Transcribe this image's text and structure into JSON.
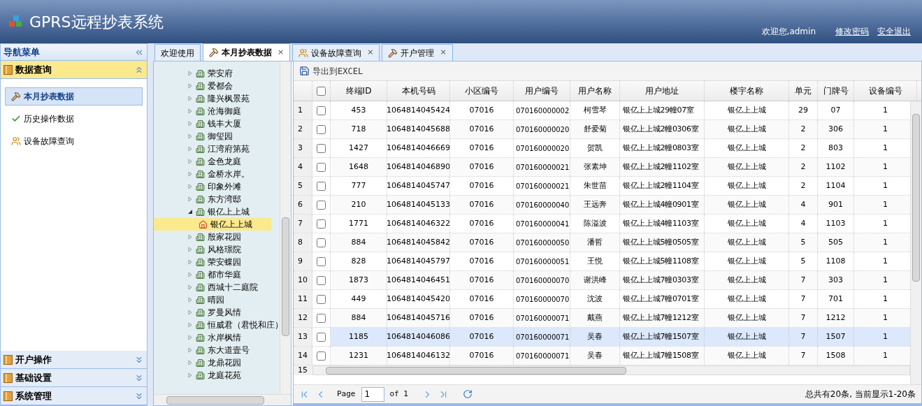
{
  "header": {
    "title": "GPRS远程抄表系统",
    "welcome": "欢迎您,admin",
    "links": [
      "修改密码",
      "安全退出"
    ]
  },
  "nav": {
    "title": "导航菜单",
    "sections": [
      {
        "label": "数据查询",
        "expanded": true,
        "items": [
          {
            "label": "本月抄表数据",
            "kind": "tool",
            "selected": true
          },
          {
            "label": "历史操作数据",
            "kind": "history",
            "selected": false
          },
          {
            "label": "设备故障查询",
            "kind": "fault",
            "selected": false
          }
        ]
      },
      {
        "label": "开户操作",
        "expanded": false
      },
      {
        "label": "基础设置",
        "expanded": false
      },
      {
        "label": "系统管理",
        "expanded": false
      }
    ]
  },
  "tabs": [
    {
      "label": "欢迎使用",
      "kind": "home",
      "selected": false
    },
    {
      "label": "本月抄表数据",
      "kind": "tool",
      "close": "×",
      "selected": true
    },
    {
      "label": "设备故障查询",
      "kind": "fault",
      "close": "×",
      "selected": false
    },
    {
      "label": "开户管理",
      "kind": "tool",
      "close": "×",
      "selected": false
    }
  ],
  "tree": [
    {
      "label": "荣安府",
      "expanded": false
    },
    {
      "label": "爱都会",
      "expanded": false
    },
    {
      "label": "隆兴枫景苑",
      "expanded": false
    },
    {
      "label": "沧海御庭",
      "expanded": false
    },
    {
      "label": "钱丰大厦",
      "expanded": false
    },
    {
      "label": "御玺园",
      "expanded": false
    },
    {
      "label": "江湾府第苑",
      "expanded": false
    },
    {
      "label": "金色龙庭",
      "expanded": false
    },
    {
      "label": "金桥水岸。",
      "expanded": false
    },
    {
      "label": "印象外滩",
      "expanded": false
    },
    {
      "label": "东方湾邸",
      "expanded": false
    },
    {
      "label": "银亿上上城",
      "expanded": true,
      "children": [
        {
          "label": "银亿上上城",
          "selected": true
        }
      ]
    },
    {
      "label": "殷家花园",
      "expanded": false
    },
    {
      "label": "风格璟院",
      "expanded": false
    },
    {
      "label": "荣安蝶园",
      "expanded": false
    },
    {
      "label": "都市华庭",
      "expanded": false
    },
    {
      "label": "西城十二庭院",
      "expanded": false
    },
    {
      "label": "晴园",
      "expanded": false
    },
    {
      "label": "罗曼风情",
      "expanded": false
    },
    {
      "label": "恒威君（君悦和庄）",
      "expanded": false
    },
    {
      "label": "水岸枫情",
      "expanded": false
    },
    {
      "label": "东大道壹号",
      "expanded": false
    },
    {
      "label": "龙鼎花园",
      "expanded": false
    },
    {
      "label": "龙庭花苑",
      "expanded": false
    }
  ],
  "grid": {
    "toolbar": "导出到EXCEL",
    "header_checked": false,
    "columns": [
      "终端ID",
      "本机号码",
      "小区编号",
      "用户编号",
      "用户名称",
      "用户地址",
      "楼宇名称",
      "单元",
      "门牌号",
      "设备编号"
    ],
    "rows": [
      {
        "num": "1",
        "checked": false,
        "selected": false,
        "cells": [
          "453",
          "1064814045424",
          "07016",
          "070160000002",
          "柯雪琴",
          "银亿上上城29幢07室",
          "银亿上上城",
          "29",
          "07",
          "1"
        ]
      },
      {
        "num": "2",
        "checked": false,
        "selected": false,
        "cells": [
          "718",
          "1064814045688",
          "07016",
          "070160000020",
          "舒爱菊",
          "银亿上上城2幢0306室",
          "银亿上上城",
          "2",
          "306",
          "1"
        ]
      },
      {
        "num": "3",
        "checked": false,
        "selected": false,
        "cells": [
          "1427",
          "1064814046669",
          "07016",
          "070160000020",
          "贺凯",
          "银亿上上城2幢0803室",
          "银亿上上城",
          "2",
          "803",
          "1"
        ]
      },
      {
        "num": "4",
        "checked": false,
        "selected": false,
        "cells": [
          "1648",
          "1064814046890",
          "07016",
          "070160000021",
          "张素坤",
          "银亿上上城2幢1102室",
          "银亿上上城",
          "2",
          "1102",
          "1"
        ]
      },
      {
        "num": "5",
        "checked": false,
        "selected": false,
        "cells": [
          "777",
          "1064814045747",
          "07016",
          "070160000021",
          "朱世苗",
          "银亿上上城2幢1104室",
          "银亿上上城",
          "2",
          "1104",
          "1"
        ]
      },
      {
        "num": "6",
        "checked": false,
        "selected": false,
        "cells": [
          "210",
          "1064814045133",
          "07016",
          "070160000040",
          "王远奔",
          "银亿上上城4幢0901室",
          "银亿上上城",
          "4",
          "901",
          "1"
        ]
      },
      {
        "num": "7",
        "checked": false,
        "selected": false,
        "cells": [
          "1771",
          "1064814046322",
          "07016",
          "070160000041",
          "陈溢波",
          "银亿上上城4幢1103室",
          "银亿上上城",
          "4",
          "1103",
          "1"
        ]
      },
      {
        "num": "8",
        "checked": false,
        "selected": false,
        "cells": [
          "884",
          "1064814045842",
          "07016",
          "070160000050",
          "潘哲",
          "银亿上上城5幢0505室",
          "银亿上上城",
          "5",
          "505",
          "1"
        ]
      },
      {
        "num": "9",
        "checked": false,
        "selected": false,
        "cells": [
          "828",
          "1064814045797",
          "07016",
          "070160000051",
          "王悦",
          "银亿上上城5幢1108室",
          "银亿上上城",
          "5",
          "1108",
          "1"
        ]
      },
      {
        "num": "10",
        "checked": false,
        "selected": false,
        "cells": [
          "1873",
          "1064814046451",
          "07016",
          "070160000070",
          "谢洪峰",
          "银亿上上城7幢0303室",
          "银亿上上城",
          "7",
          "303",
          "1"
        ]
      },
      {
        "num": "11",
        "checked": false,
        "selected": false,
        "cells": [
          "449",
          "1064814045420",
          "07016",
          "070160000070",
          "沈波",
          "银亿上上城7幢0701室",
          "银亿上上城",
          "7",
          "701",
          "1"
        ]
      },
      {
        "num": "12",
        "checked": false,
        "selected": false,
        "cells": [
          "884",
          "1064814045716",
          "07016",
          "070160000071",
          "戴燕",
          "银亿上上城7幢1212室",
          "银亿上上城",
          "7",
          "1212",
          "1"
        ]
      },
      {
        "num": "13",
        "checked": false,
        "selected": true,
        "cells": [
          "1185",
          "1064814046086",
          "07016",
          "070160000071",
          "吴春",
          "银亿上上城7幢1507室",
          "银亿上上城",
          "7",
          "1507",
          "1"
        ]
      },
      {
        "num": "14",
        "checked": false,
        "selected": false,
        "cells": [
          "1231",
          "1064814046132",
          "07016",
          "070160000071",
          "吴春",
          "银亿上上城7幢1508室",
          "银亿上上城",
          "7",
          "1508",
          "1"
        ]
      }
    ],
    "cut_row_number": "15"
  },
  "pager": {
    "page_label": "Page",
    "page": "1",
    "of": "of 1",
    "summary": "总共有20条, 当前显示1-20条"
  }
}
